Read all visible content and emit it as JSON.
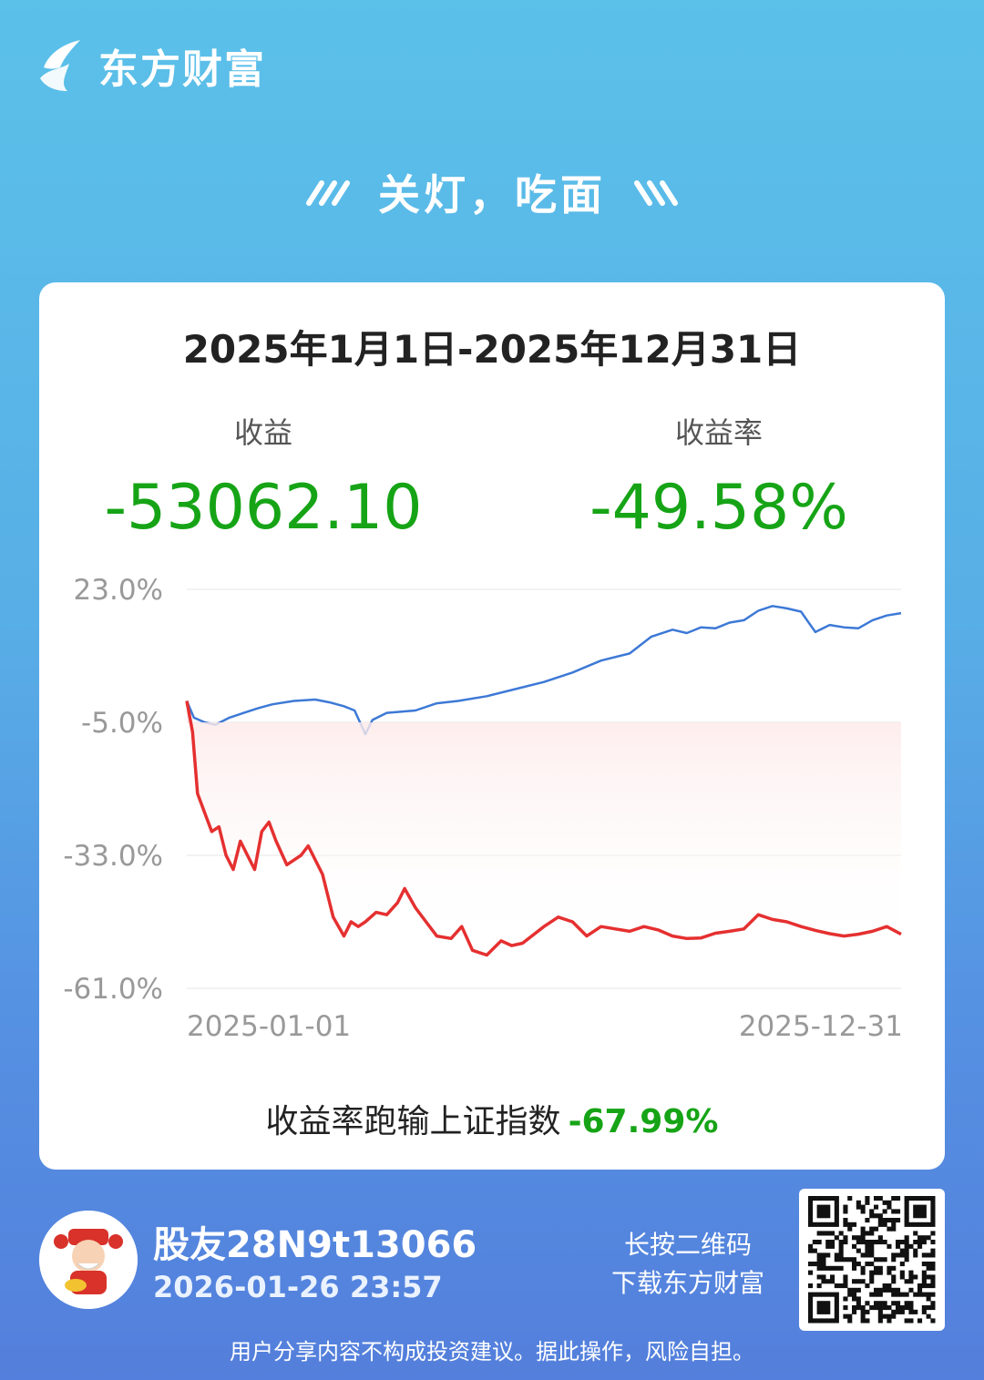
{
  "brand": {
    "name": "东方财富",
    "icon": "brand-logo-icon"
  },
  "slogan": {
    "text": "关灯，吃面"
  },
  "card": {
    "period": "2025年1月1日-2025年12月31日",
    "profit_label": "收益",
    "profit_value": "-53062.10",
    "rate_label": "收益率",
    "rate_value": "-49.58%",
    "compare_label": "收益率跑输上证指数",
    "compare_value": "-67.99%"
  },
  "chart_data": {
    "type": "line",
    "ylim": [
      -61.0,
      23.0
    ],
    "ytick_labels": [
      "23.0%",
      "-5.0%",
      "-33.0%",
      "-61.0%"
    ],
    "x_start_label": "2025-01-01",
    "x_end_label": "2025-12-31",
    "grid": true,
    "series": [
      {
        "color": "#3d79d6",
        "x": [
          0,
          0.01,
          0.025,
          0.04,
          0.06,
          0.08,
          0.1,
          0.12,
          0.15,
          0.18,
          0.2,
          0.22,
          0.235,
          0.25,
          0.26,
          0.28,
          0.32,
          0.35,
          0.38,
          0.42,
          0.46,
          0.5,
          0.54,
          0.58,
          0.62,
          0.65,
          0.68,
          0.7,
          0.72,
          0.74,
          0.76,
          0.78,
          0.8,
          0.82,
          0.84,
          0.86,
          0.88,
          0.9,
          0.92,
          0.94,
          0.96,
          0.98,
          1.0
        ],
        "values": [
          -0.5,
          -4,
          -5,
          -5.5,
          -4,
          -3,
          -2,
          -1.2,
          -0.5,
          -0.2,
          -0.8,
          -1.6,
          -2.5,
          -7.5,
          -4.5,
          -3,
          -2.5,
          -1,
          -0.5,
          0.5,
          2,
          3.5,
          5.5,
          8,
          9.5,
          13,
          14.5,
          13.8,
          15,
          14.8,
          16,
          16.5,
          18.5,
          19.5,
          19,
          18.3,
          14,
          15.5,
          15,
          14.8,
          16.5,
          17.5,
          18
        ]
      },
      {
        "color": "#e53030",
        "x": [
          0,
          0.008,
          0.015,
          0.025,
          0.035,
          0.045,
          0.055,
          0.065,
          0.075,
          0.085,
          0.095,
          0.105,
          0.115,
          0.125,
          0.14,
          0.15,
          0.16,
          0.17,
          0.19,
          0.205,
          0.22,
          0.23,
          0.24,
          0.25,
          0.265,
          0.28,
          0.295,
          0.305,
          0.32,
          0.335,
          0.35,
          0.37,
          0.385,
          0.4,
          0.42,
          0.44,
          0.455,
          0.47,
          0.5,
          0.52,
          0.54,
          0.56,
          0.58,
          0.6,
          0.62,
          0.64,
          0.66,
          0.68,
          0.7,
          0.72,
          0.74,
          0.76,
          0.78,
          0.8,
          0.82,
          0.84,
          0.86,
          0.88,
          0.9,
          0.92,
          0.94,
          0.96,
          0.98,
          1.0
        ],
        "values": [
          -0.5,
          -7,
          -20,
          -24,
          -28,
          -27,
          -33,
          -36,
          -30,
          -33,
          -36,
          -28,
          -26,
          -30,
          -35,
          -34,
          -33,
          -31,
          -37,
          -46,
          -50,
          -47,
          -48,
          -47,
          -45,
          -45.5,
          -43,
          -40,
          -44,
          -47,
          -50,
          -50.5,
          -48,
          -53,
          -54,
          -51,
          -52,
          -51.5,
          -48,
          -46,
          -47,
          -50,
          -48,
          -48.5,
          -49,
          -48,
          -48.7,
          -50,
          -50.5,
          -50.4,
          -49.4,
          -49,
          -48.5,
          -45.5,
          -46.5,
          -47,
          -48,
          -48.8,
          -49.5,
          -50,
          -49.6,
          -49,
          -48,
          -49.6
        ]
      }
    ]
  },
  "user": {
    "name": "股友28N9t13066",
    "time": "2026-01-26 23:57",
    "avatar": "god-of-wealth-avatar"
  },
  "qr": {
    "hint_line1": "长按二维码",
    "hint_line2": "下载东方财富"
  },
  "disclaimer": "用户分享内容不构成投资建议。据此操作，风险自担。"
}
